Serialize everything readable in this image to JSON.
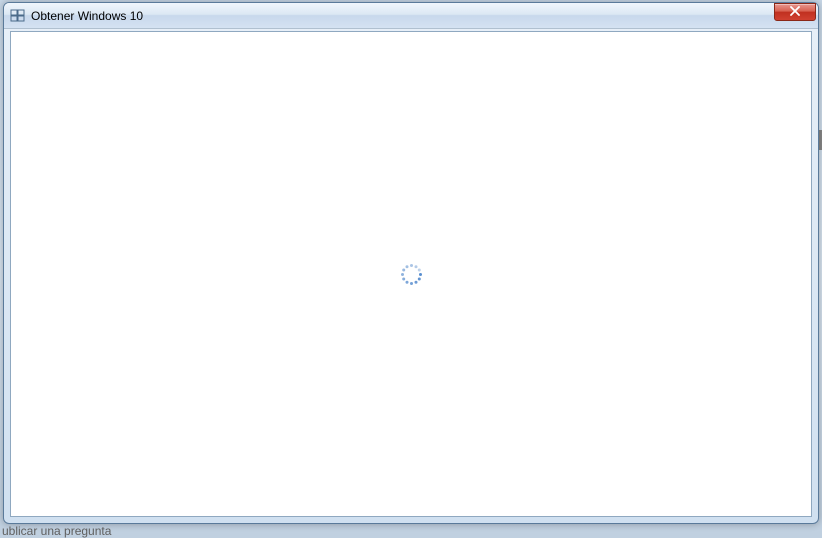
{
  "window": {
    "title": "Obtener Windows 10",
    "icon": "windows-logo-icon",
    "close_label": "Close"
  },
  "content": {
    "state": "loading"
  },
  "spinner": {
    "dot_count": 12,
    "radius": 9,
    "base_color": "#5a8fd0",
    "fade_color": "#c8d8ec"
  },
  "background": {
    "partial_text": "ublicar una pregunta"
  }
}
